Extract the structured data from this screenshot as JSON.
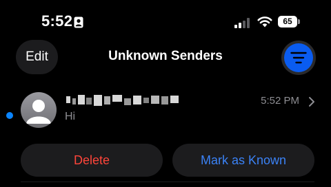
{
  "status_bar": {
    "time": "5:52",
    "battery_level": "65",
    "icons": [
      "focus-person-icon",
      "cellular-signal-icon",
      "wifi-icon",
      "battery-icon"
    ]
  },
  "nav": {
    "edit_label": "Edit",
    "title": "Unknown Senders",
    "filter_icon": "filter-lines-icon",
    "accent_color": "#0a5cf0"
  },
  "message": {
    "sender": "",
    "time": "5:52 PM",
    "preview": "Hi",
    "unread": true,
    "unread_color": "#0a84ff",
    "avatar_icon": "person-silhouette-icon"
  },
  "actions": {
    "delete_label": "Delete",
    "delete_color": "#ff453a",
    "mark_known_label": "Mark as Known",
    "mark_known_color": "#3b82f6"
  }
}
